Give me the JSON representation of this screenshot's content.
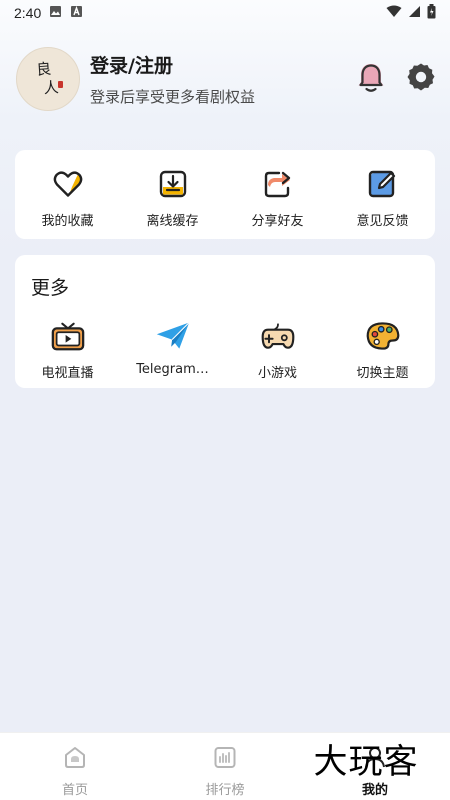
{
  "status_bar": {
    "time": "2:40"
  },
  "profile": {
    "avatar_line1": "良",
    "avatar_line2": "人",
    "title": "登录/注册",
    "subtitle": "登录后享受更多看剧权益"
  },
  "quick_actions": [
    {
      "label": "我的收藏",
      "icon": "heart-icon"
    },
    {
      "label": "离线缓存",
      "icon": "download-icon"
    },
    {
      "label": "分享好友",
      "icon": "share-icon"
    },
    {
      "label": "意见反馈",
      "icon": "edit-icon"
    }
  ],
  "more": {
    "title": "更多",
    "items": [
      {
        "label": "电视直播",
        "icon": "tv-icon"
      },
      {
        "label": "Telegram…",
        "icon": "telegram-icon"
      },
      {
        "label": "小游戏",
        "icon": "gamepad-icon"
      },
      {
        "label": "切换主题",
        "icon": "palette-icon"
      }
    ]
  },
  "bottom_nav": [
    {
      "label": "首页",
      "icon": "home-icon"
    },
    {
      "label": "排行榜",
      "icon": "chart-icon"
    },
    {
      "label": "我的",
      "icon": "profile-icon",
      "active": true
    }
  ],
  "watermark": "大玩客",
  "colors": {
    "accent": "#f5b400",
    "page_bg": "#ebeef7",
    "card_bg": "#ffffff"
  }
}
